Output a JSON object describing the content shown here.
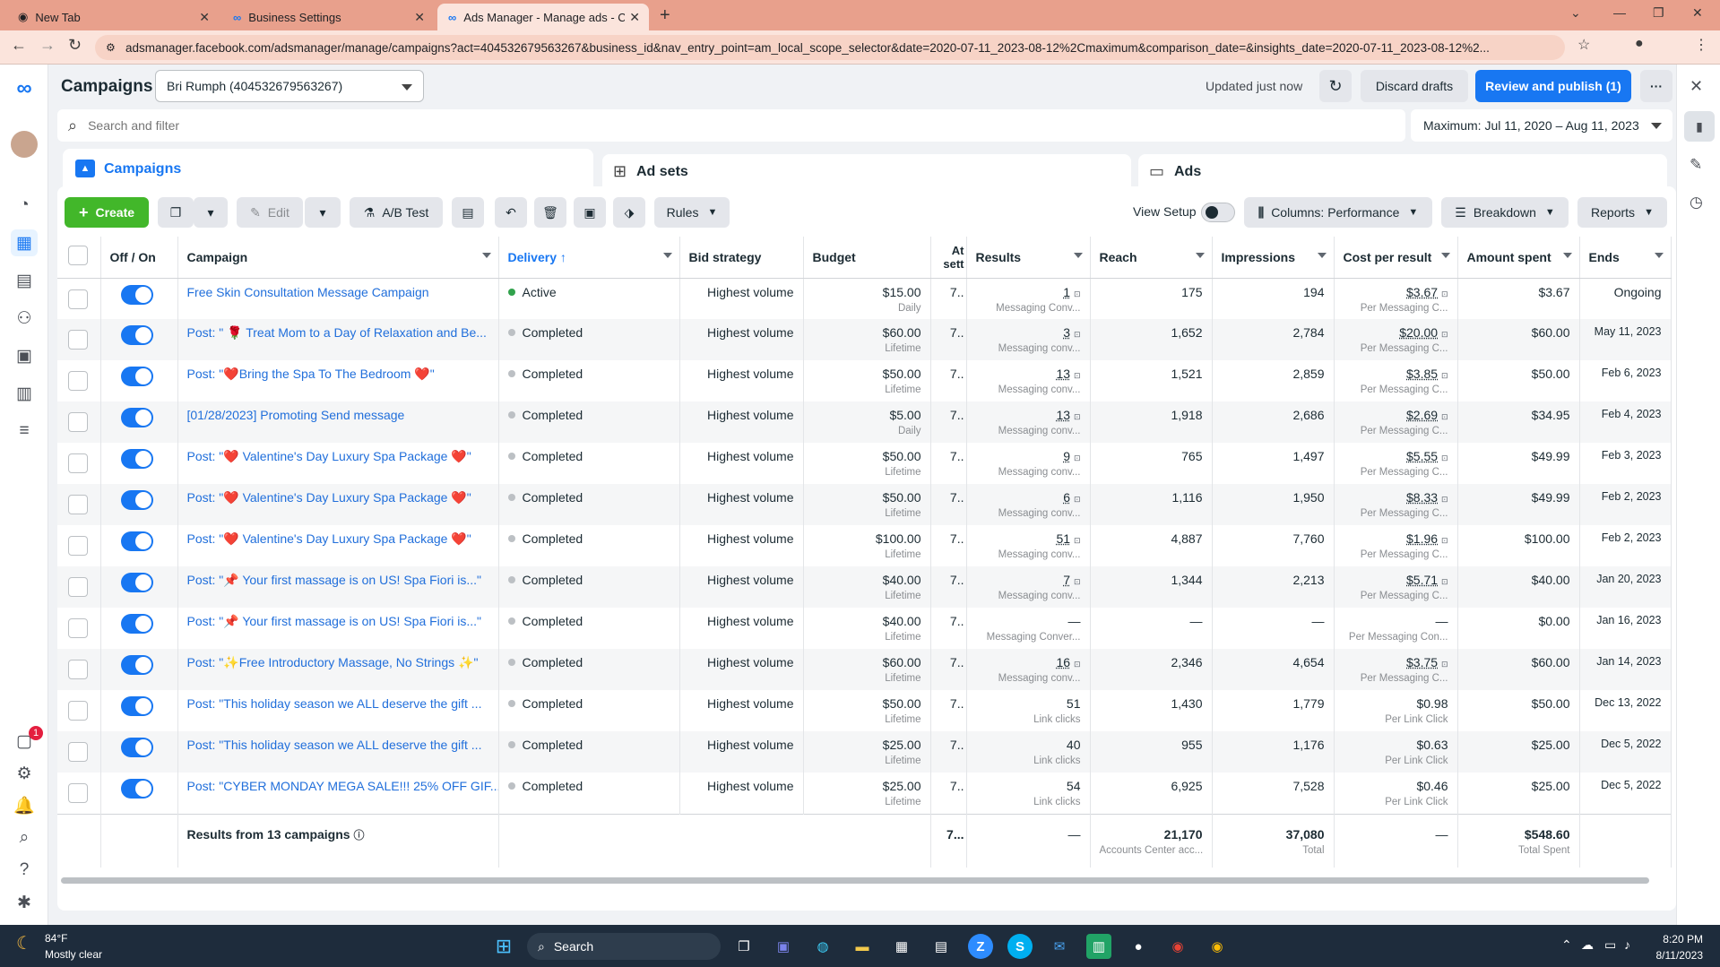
{
  "browser": {
    "tabs": [
      {
        "title": "New Tab"
      },
      {
        "title": "Business Settings"
      },
      {
        "title": "Ads Manager - Manage ads - Ca"
      }
    ],
    "url": "adsmanager.facebook.com/adsmanager/manage/campaigns?act=404532679563267&business_id&nav_entry_point=am_local_scope_selector&date=2020-07-11_2023-08-12%2Cmaximum&comparison_date=&insights_date=2020-07-11_2023-08-12%2..."
  },
  "header": {
    "title": "Campaigns",
    "account": "Bri Rumph (404532679563267)",
    "updated": "Updated just now",
    "discard": "Discard drafts",
    "review": "Review and publish (1)",
    "more": "···"
  },
  "search": {
    "placeholder": "Search and filter"
  },
  "date_range": "Maximum: Jul 11, 2020 – Aug 11, 2023",
  "level_tabs": [
    {
      "label": "Campaigns"
    },
    {
      "label": "Ad sets"
    },
    {
      "label": "Ads"
    }
  ],
  "toolbar": {
    "create": "Create",
    "edit": "Edit",
    "ab_test": "A/B Test",
    "rules": "Rules",
    "view_setup": "View Setup",
    "columns": "Columns: Performance",
    "breakdown": "Breakdown",
    "reports": "Reports"
  },
  "columns": [
    "Off / On",
    "Campaign",
    "Delivery ↑",
    "Bid strategy",
    "Budget",
    "At sett",
    "Results",
    "Reach",
    "Impressions",
    "Cost per result",
    "Amount spent",
    "Ends"
  ],
  "rows": [
    {
      "campaign": "Free Skin Consultation Message Campaign",
      "delivery": "Active",
      "bid": "Highest volume",
      "budget": "$15.00",
      "budget_type": "Daily",
      "att": "7..",
      "results": "1",
      "results_type": "Messaging Conv...",
      "reach": "175",
      "impressions": "194",
      "cpr": "$3.67",
      "cpr_type": "Per Messaging C...",
      "spent": "$3.67",
      "ends": "Ongoing"
    },
    {
      "campaign": "Post: \" 🌹 Treat Mom to a Day of Relaxation and Be...",
      "delivery": "Completed",
      "bid": "Highest volume",
      "budget": "$60.00",
      "budget_type": "Lifetime",
      "att": "7..",
      "results": "3",
      "results_type": "Messaging conv...",
      "reach": "1,652",
      "impressions": "2,784",
      "cpr": "$20.00",
      "cpr_type": "Per Messaging C...",
      "spent": "$60.00",
      "ends": "May 11, 2023"
    },
    {
      "campaign": "Post: \"❤️Bring the Spa To The Bedroom ❤️\"",
      "delivery": "Completed",
      "bid": "Highest volume",
      "budget": "$50.00",
      "budget_type": "Lifetime",
      "att": "7..",
      "results": "13",
      "results_type": "Messaging conv...",
      "reach": "1,521",
      "impressions": "2,859",
      "cpr": "$3.85",
      "cpr_type": "Per Messaging C...",
      "spent": "$50.00",
      "ends": "Feb 6, 2023"
    },
    {
      "campaign": "[01/28/2023] Promoting Send message",
      "delivery": "Completed",
      "bid": "Highest volume",
      "budget": "$5.00",
      "budget_type": "Daily",
      "att": "7..",
      "results": "13",
      "results_type": "Messaging conv...",
      "reach": "1,918",
      "impressions": "2,686",
      "cpr": "$2.69",
      "cpr_type": "Per Messaging C...",
      "spent": "$34.95",
      "ends": "Feb 4, 2023"
    },
    {
      "campaign": "Post: \"❤️ Valentine's Day Luxury Spa Package ❤️\"",
      "delivery": "Completed",
      "bid": "Highest volume",
      "budget": "$50.00",
      "budget_type": "Lifetime",
      "att": "7..",
      "results": "9",
      "results_type": "Messaging conv...",
      "reach": "765",
      "impressions": "1,497",
      "cpr": "$5.55",
      "cpr_type": "Per Messaging C...",
      "spent": "$49.99",
      "ends": "Feb 3, 2023"
    },
    {
      "campaign": "Post: \"❤️ Valentine's Day Luxury Spa Package ❤️\"",
      "delivery": "Completed",
      "bid": "Highest volume",
      "budget": "$50.00",
      "budget_type": "Lifetime",
      "att": "7..",
      "results": "6",
      "results_type": "Messaging conv...",
      "reach": "1,116",
      "impressions": "1,950",
      "cpr": "$8.33",
      "cpr_type": "Per Messaging C...",
      "spent": "$49.99",
      "ends": "Feb 2, 2023"
    },
    {
      "campaign": "Post: \"❤️ Valentine's Day Luxury Spa Package ❤️\"",
      "delivery": "Completed",
      "bid": "Highest volume",
      "budget": "$100.00",
      "budget_type": "Lifetime",
      "att": "7..",
      "results": "51",
      "results_type": "Messaging conv...",
      "reach": "4,887",
      "impressions": "7,760",
      "cpr": "$1.96",
      "cpr_type": "Per Messaging C...",
      "spent": "$100.00",
      "ends": "Feb 2, 2023"
    },
    {
      "campaign": "Post: \"📌 Your first massage is on US! Spa Fiori is...\"",
      "delivery": "Completed",
      "bid": "Highest volume",
      "budget": "$40.00",
      "budget_type": "Lifetime",
      "att": "7..",
      "results": "7",
      "results_type": "Messaging conv...",
      "reach": "1,344",
      "impressions": "2,213",
      "cpr": "$5.71",
      "cpr_type": "Per Messaging C...",
      "spent": "$40.00",
      "ends": "Jan 20, 2023"
    },
    {
      "campaign": "Post: \"📌 Your first massage is on US! Spa Fiori is...\"",
      "delivery": "Completed",
      "bid": "Highest volume",
      "budget": "$40.00",
      "budget_type": "Lifetime",
      "att": "7..",
      "results": "—",
      "results_type": "Messaging Conver...",
      "reach": "—",
      "impressions": "—",
      "cpr": "—",
      "cpr_type": "Per Messaging Con...",
      "spent": "$0.00",
      "ends": "Jan 16, 2023"
    },
    {
      "campaign": "Post: \"✨Free Introductory Massage, No Strings ✨\"",
      "delivery": "Completed",
      "bid": "Highest volume",
      "budget": "$60.00",
      "budget_type": "Lifetime",
      "att": "7..",
      "results": "16",
      "results_type": "Messaging conv...",
      "reach": "2,346",
      "impressions": "4,654",
      "cpr": "$3.75",
      "cpr_type": "Per Messaging C...",
      "spent": "$60.00",
      "ends": "Jan 14, 2023"
    },
    {
      "campaign": "Post: \"This holiday season we ALL deserve the gift ...",
      "delivery": "Completed",
      "bid": "Highest volume",
      "budget": "$50.00",
      "budget_type": "Lifetime",
      "att": "7..",
      "results": "51",
      "results_type": "Link clicks",
      "reach": "1,430",
      "impressions": "1,779",
      "cpr": "$0.98",
      "cpr_type": "Per Link Click",
      "spent": "$50.00",
      "ends": "Dec 13, 2022"
    },
    {
      "campaign": "Post: \"This holiday season we ALL deserve the gift ...",
      "delivery": "Completed",
      "bid": "Highest volume",
      "budget": "$25.00",
      "budget_type": "Lifetime",
      "att": "7..",
      "results": "40",
      "results_type": "Link clicks",
      "reach": "955",
      "impressions": "1,176",
      "cpr": "$0.63",
      "cpr_type": "Per Link Click",
      "spent": "$25.00",
      "ends": "Dec 5, 2022"
    },
    {
      "campaign": "Post: \"CYBER MONDAY MEGA SALE!!! 25% OFF GIF...",
      "delivery": "Completed",
      "bid": "Highest volume",
      "budget": "$25.00",
      "budget_type": "Lifetime",
      "att": "7..",
      "results": "54",
      "results_type": "Link clicks",
      "reach": "6,925",
      "impressions": "7,528",
      "cpr": "$0.46",
      "cpr_type": "Per Link Click",
      "spent": "$25.00",
      "ends": "Dec 5, 2022"
    }
  ],
  "summary": {
    "label": "Results from 13 campaigns",
    "att": "7...",
    "results": "—",
    "reach": "21,170",
    "reach_sub": "Accounts Center acc...",
    "impressions": "37,080",
    "impressions_sub": "Total",
    "cpr": "—",
    "spent": "$548.60",
    "spent_sub": "Total Spent"
  },
  "left_badge": "1",
  "taskbar": {
    "weather_temp": "84°F",
    "weather_desc": "Mostly clear",
    "search": "Search",
    "time": "8:20 PM",
    "date": "8/11/2023"
  },
  "colors": {
    "accent": "#1877f2",
    "create_green": "#42b72a",
    "active_green": "#31a24c",
    "completed_gray": "#bcc0c4",
    "tabbar": "#e8a08c"
  }
}
